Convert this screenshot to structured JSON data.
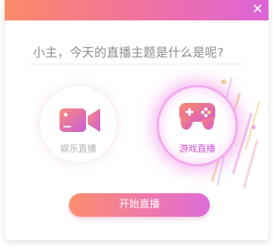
{
  "window": {
    "close_icon": "close-icon"
  },
  "topic": {
    "placeholder": "小主，今天的直播主题是什么是呢?"
  },
  "categories": [
    {
      "label": "娱乐直播",
      "icon": "video-camera-icon",
      "selected": false
    },
    {
      "label": "游戏直播",
      "icon": "gamepad-icon",
      "selected": true
    }
  ],
  "start_button": {
    "label": "开始直播"
  },
  "colors": {
    "gradient_start": "#fb8a66",
    "gradient_mid": "#f071a4",
    "gradient_end": "#dd64d8",
    "selected_label": "#d04bd4",
    "unselected_label": "#b0b0b0"
  }
}
